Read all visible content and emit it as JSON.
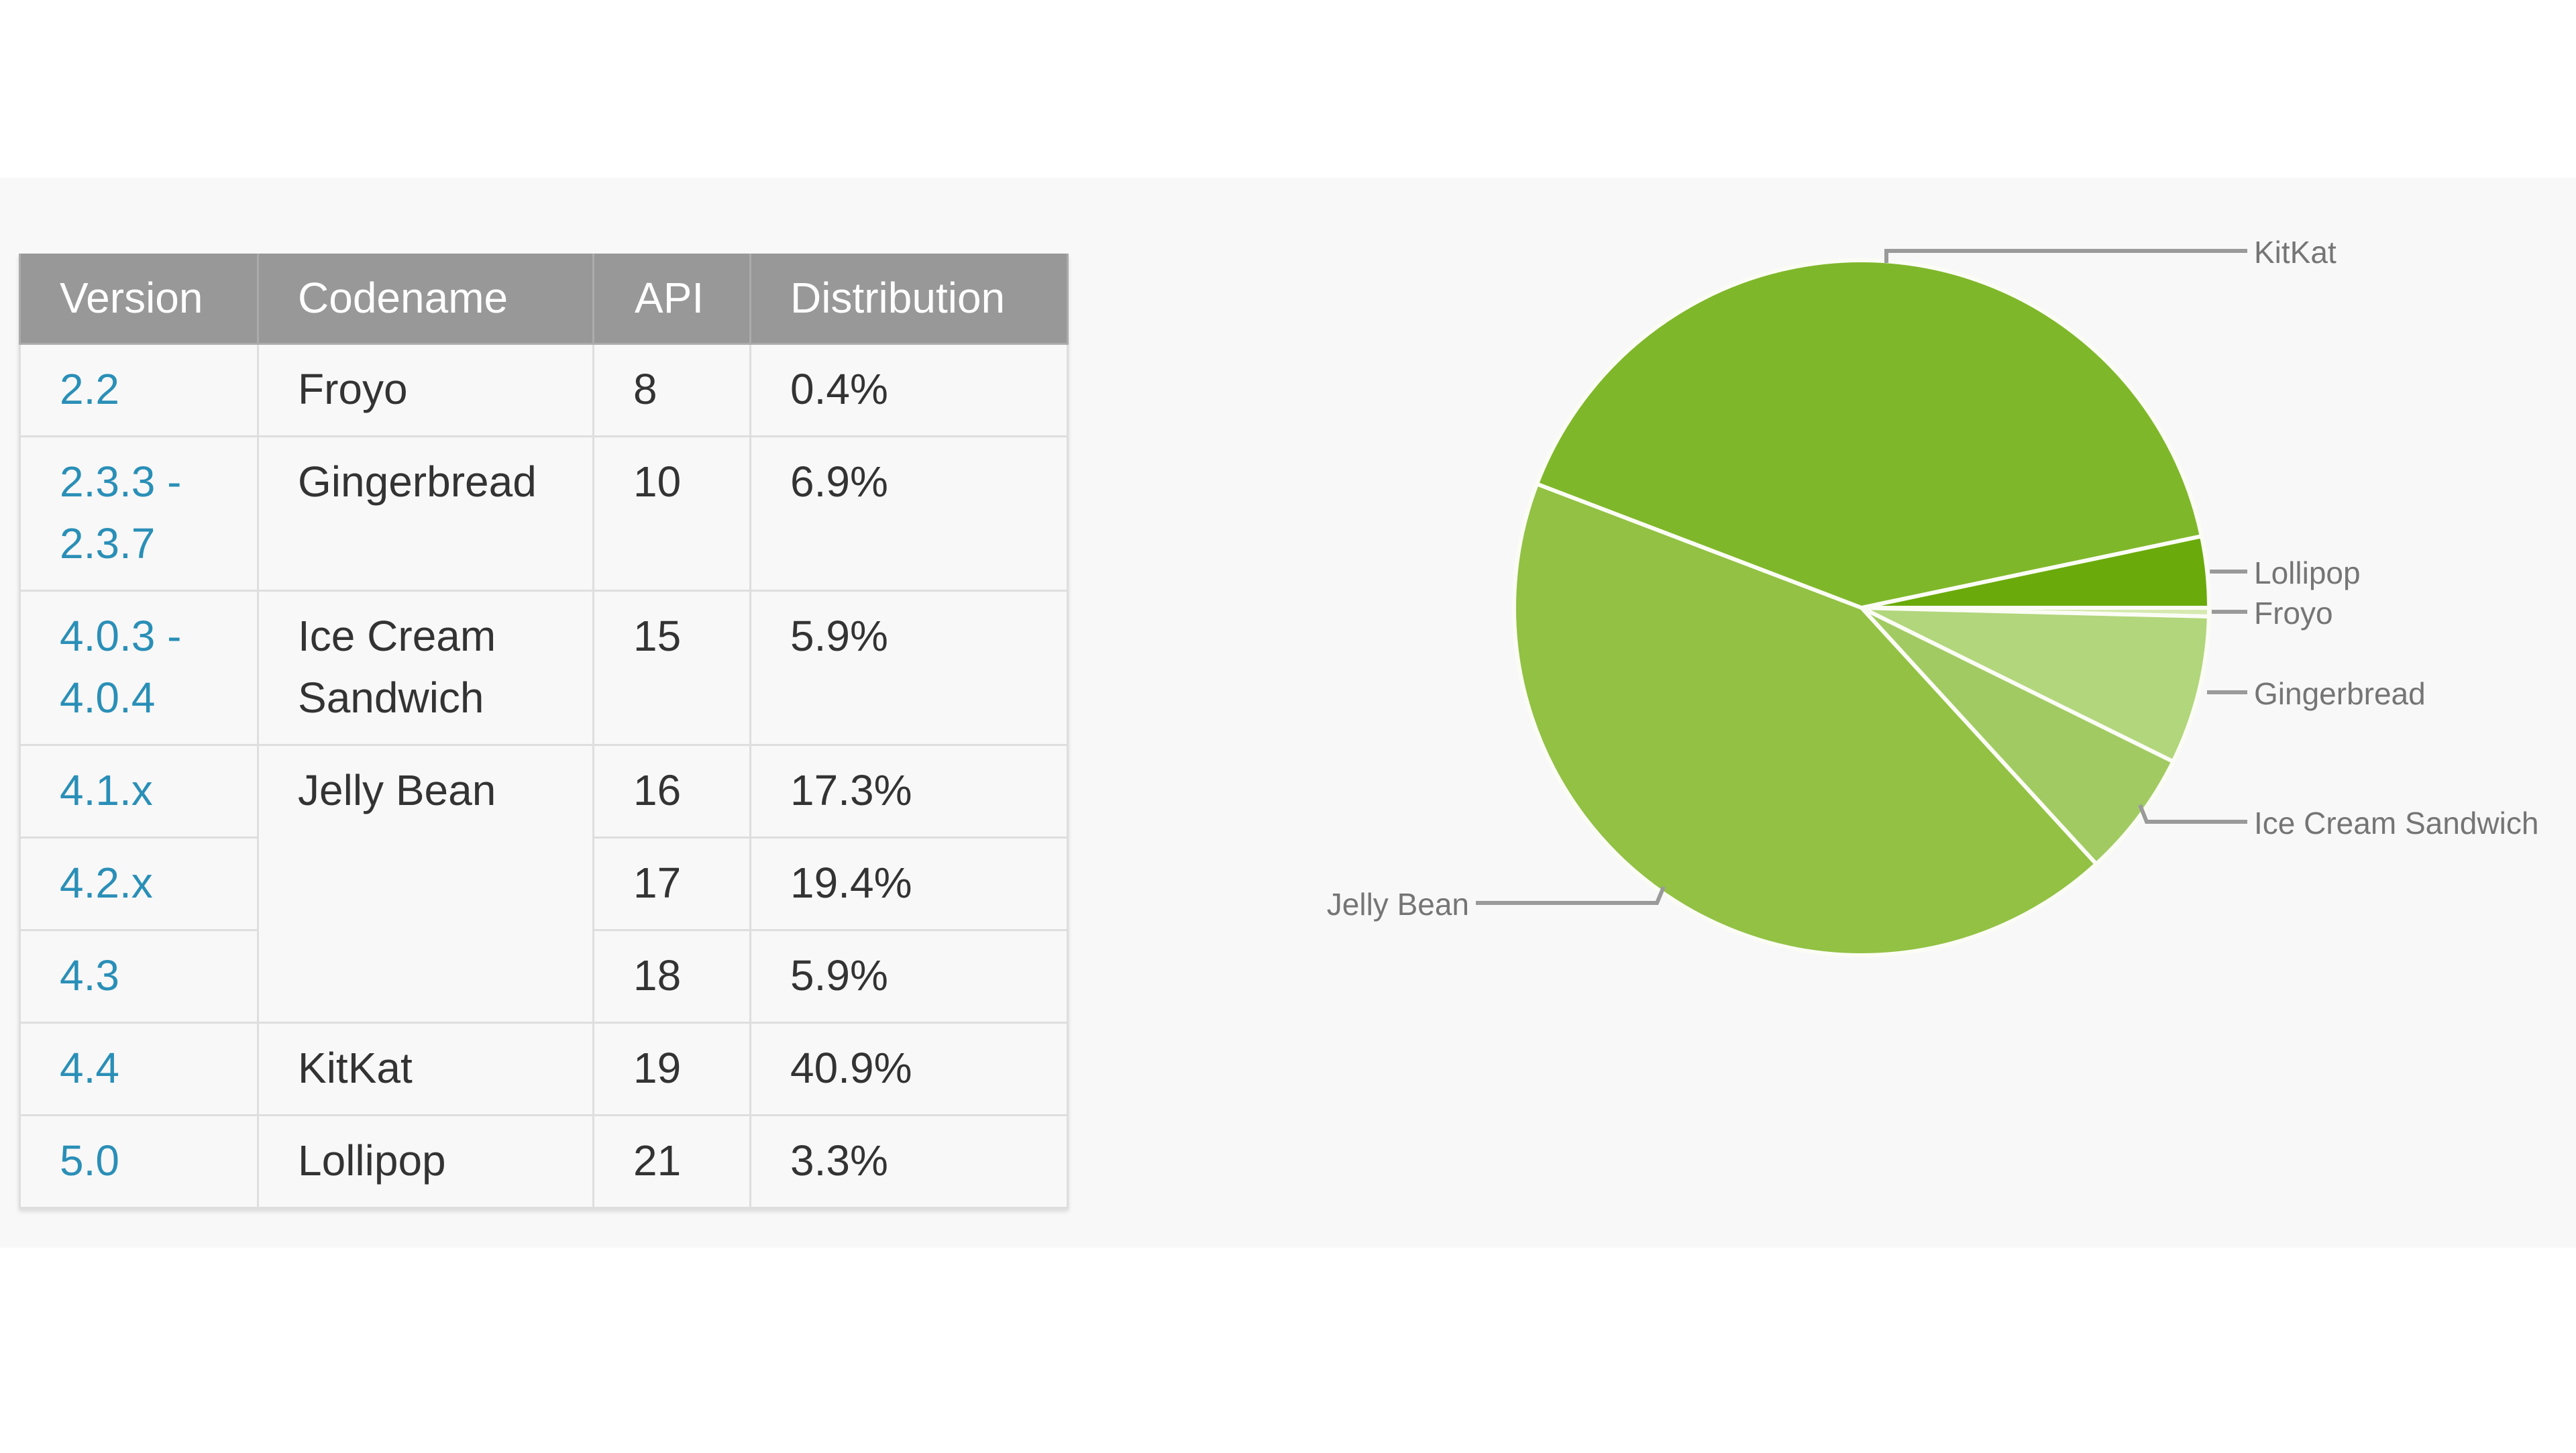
{
  "table": {
    "headers": [
      "Version",
      "Codename",
      "API",
      "Distribution"
    ],
    "rows": [
      {
        "version": "2.2",
        "codename": "Froyo",
        "api": "8",
        "distribution": "0.4%"
      },
      {
        "version": "2.3.3 -\n2.3.7",
        "codename": "Gingerbread",
        "api": "10",
        "distribution": "6.9%"
      },
      {
        "version": "4.0.3 -\n4.0.4",
        "codename": "Ice Cream\nSandwich",
        "api": "15",
        "distribution": "5.9%"
      },
      {
        "version": "4.1.x",
        "codename": "Jelly Bean",
        "api": "16",
        "distribution": "17.3%"
      },
      {
        "version": "4.2.x",
        "codename": "",
        "api": "17",
        "distribution": "19.4%"
      },
      {
        "version": "4.3",
        "codename": "",
        "api": "18",
        "distribution": "5.9%"
      },
      {
        "version": "4.4",
        "codename": "KitKat",
        "api": "19",
        "distribution": "40.9%"
      },
      {
        "version": "5.0",
        "codename": "Lollipop",
        "api": "21",
        "distribution": "3.3%"
      }
    ]
  },
  "colors": {
    "header_bg": "#989898",
    "version_link": "#2a8fb7",
    "label_text": "#757575"
  },
  "chart_data": {
    "type": "pie",
    "title": "",
    "start": "3 o'clock, clockwise",
    "slices": [
      {
        "label": "Froyo",
        "value": 0.4,
        "color": "#d6e9b0"
      },
      {
        "label": "Gingerbread",
        "value": 6.9,
        "color": "#b2d67c"
      },
      {
        "label": "Ice Cream Sandwich",
        "value": 5.9,
        "color": "#a1cb62"
      },
      {
        "label": "Jelly Bean",
        "value": 42.6,
        "color": "#92c144"
      },
      {
        "label": "KitKat",
        "value": 40.9,
        "color": "#7fb72a"
      },
      {
        "label": "Lollipop",
        "value": 3.3,
        "color": "#6aab0b"
      }
    ]
  }
}
